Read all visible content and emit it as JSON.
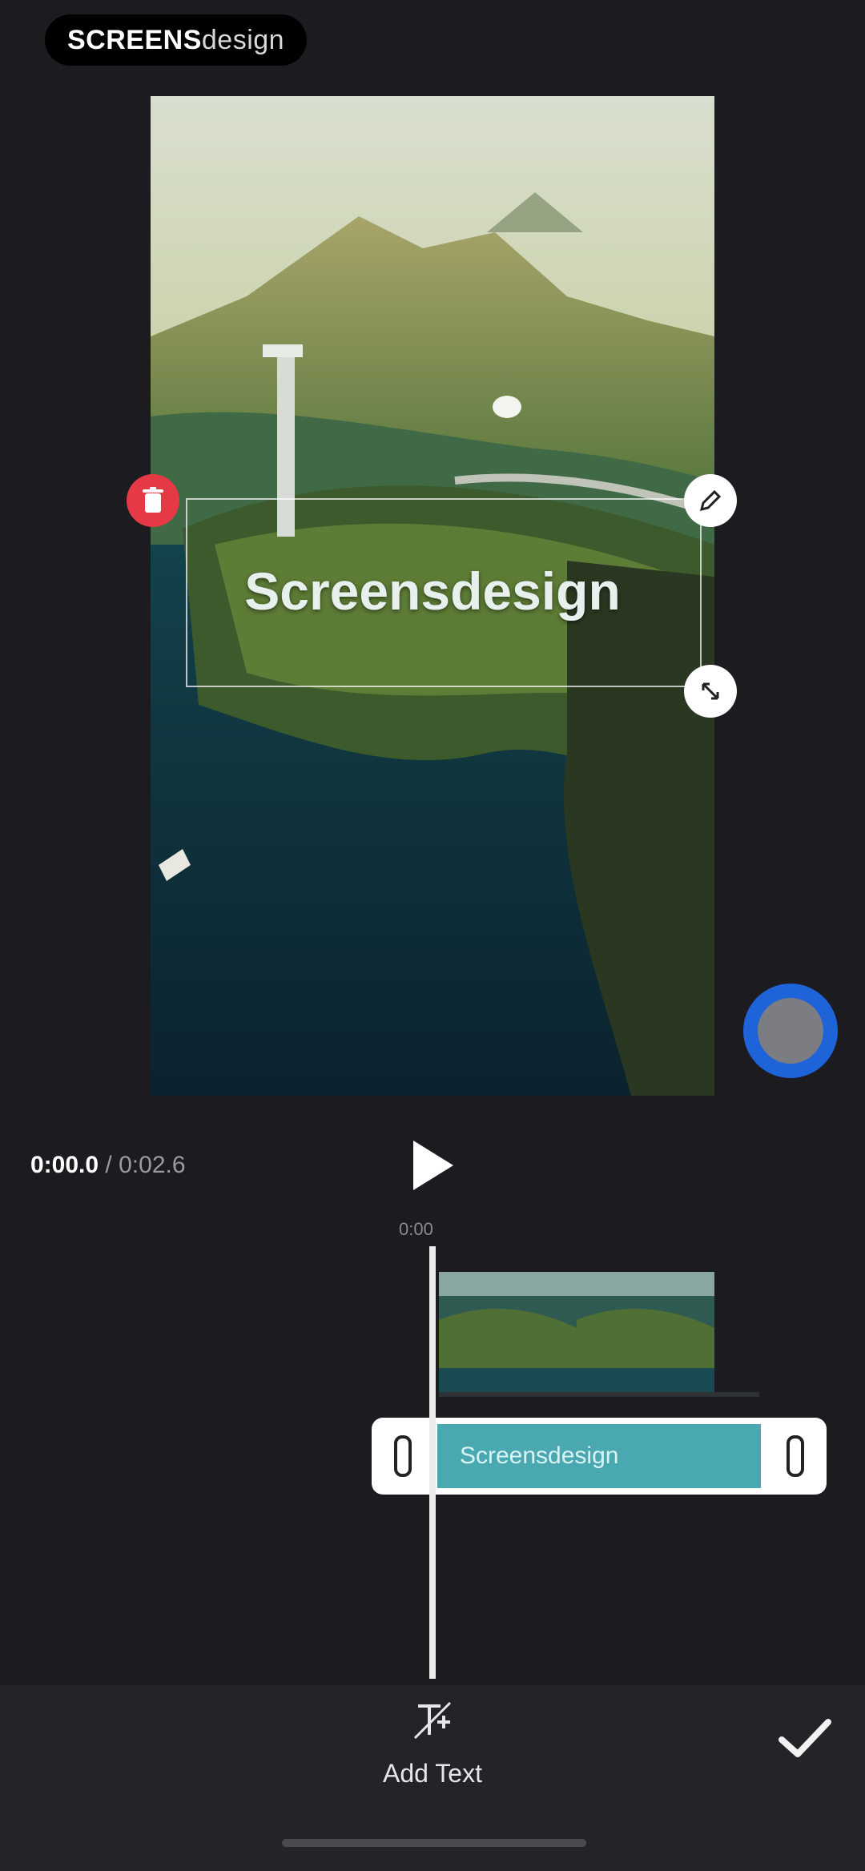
{
  "watermark": {
    "strong": "SCREENS",
    "light": "design"
  },
  "preview": {
    "overlay_text": "Screensdesign"
  },
  "player": {
    "current_time": "0:00.0",
    "separator": "/",
    "total_time": "0:02.6",
    "ruler_label": "0:00"
  },
  "timeline": {
    "text_track_label": "Screensdesign"
  },
  "bottom": {
    "add_text_label": "Add Text"
  },
  "colors": {
    "delete": "#e53946",
    "accent_blue": "#1e63d8",
    "text_track": "#4aa9b0"
  },
  "icons": [
    "delete-icon",
    "edit-icon",
    "scale-rotate-icon",
    "play-icon",
    "add-text-icon",
    "checkmark-icon"
  ]
}
